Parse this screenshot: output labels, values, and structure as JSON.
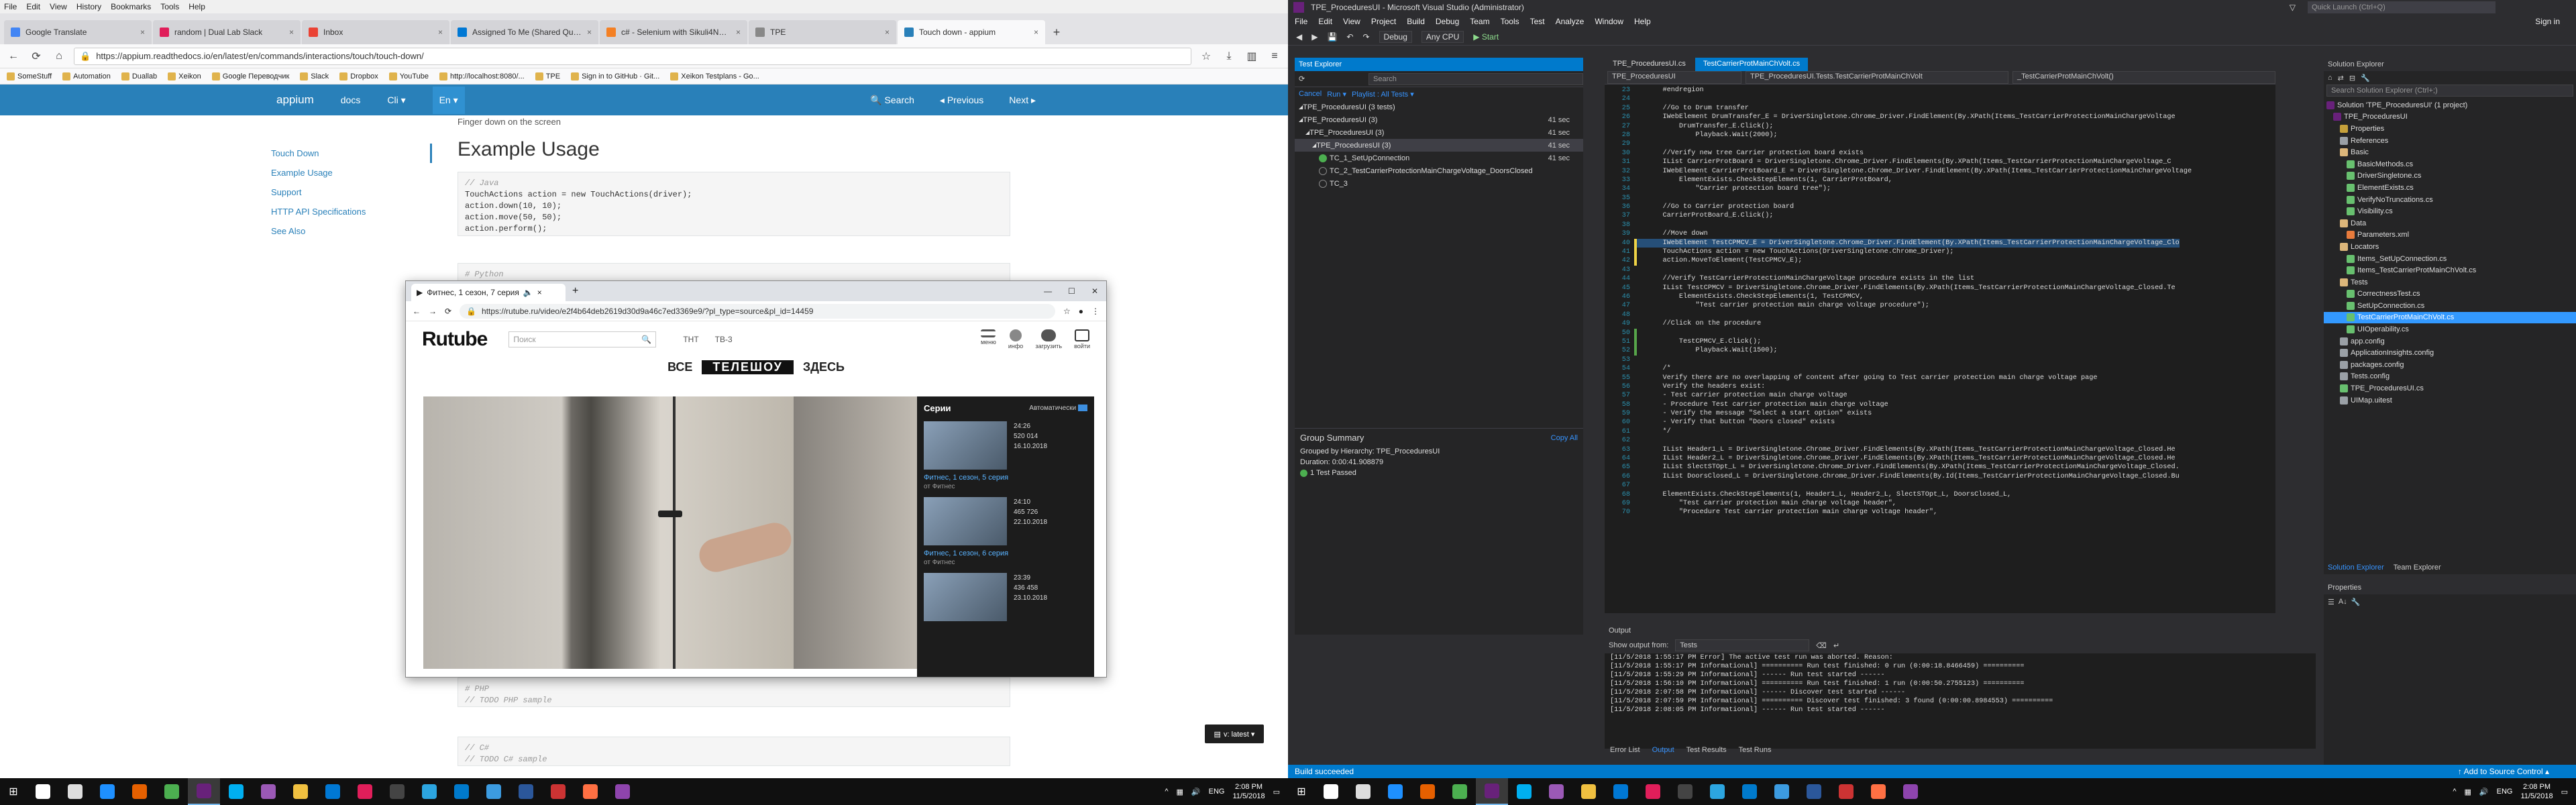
{
  "firefox": {
    "menu": [
      "File",
      "Edit",
      "View",
      "History",
      "Bookmarks",
      "Tools",
      "Help"
    ],
    "tabs": [
      {
        "label": "Google Translate",
        "color": "#4285f4",
        "active": false
      },
      {
        "label": "random | Dual Lab Slack",
        "color": "#e01e5a",
        "active": false
      },
      {
        "label": "Inbox",
        "color": "#ea4335",
        "active": false
      },
      {
        "label": "Assigned To Me (Shared Quer...",
        "color": "#0078d4",
        "active": false
      },
      {
        "label": "c# - Selenium with Sikuli4Net...",
        "color": "#f48024",
        "active": false
      },
      {
        "label": "TPE",
        "color": "#888888",
        "active": false
      },
      {
        "label": "Touch down - appium",
        "color": "#2980b9",
        "active": true
      }
    ],
    "url": "https://appium.readthedocs.io/en/latest/en/commands/interactions/touch/touch-down/",
    "bookmarks": [
      "SomeStuff",
      "Automation",
      "Duallab",
      "Xeikon",
      "Google Переводчик",
      "Slack",
      "Dropbox",
      "YouTube",
      "http://localhost:8080/...",
      "TPE",
      "Sign in to GitHub · Git...",
      "Xeikon Testplans - Go..."
    ]
  },
  "appium": {
    "brand": "appium",
    "nav": [
      "docs",
      "Cli ▾",
      "En ▾"
    ],
    "right_nav": [
      "Search",
      "◂ Previous",
      "Next ▸"
    ],
    "subtitle": "Finger down on the screen",
    "sidebar": [
      "Touch Down",
      "Example Usage",
      "Support",
      "HTTP API Specifications",
      "See Also"
    ],
    "title": "Example Usage",
    "code_java": [
      "// Java",
      "TouchActions action = new TouchActions(driver);",
      "action.down(10, 10);",
      "action.move(50, 50);",
      "action.perform();"
    ],
    "code_python": [
      "# Python"
    ],
    "code_php": [
      "# PHP",
      "// TODO PHP sample"
    ],
    "code_cs": [
      "// C#",
      "// TODO C# sample"
    ],
    "latest_label": "v: latest ▾"
  },
  "rutube": {
    "tab_label": "Фитнес, 1 сезон, 7 серия",
    "url": "https://rutube.ru/video/e2f4b64deb2619d30d9a46c7ed3369e9/?pl_type=source&pl_id=14459",
    "logo": "Rutube",
    "search_placeholder": "Поиск",
    "channels": [
      "ТНТ",
      "ТВ-3"
    ],
    "icons": [
      "меню",
      "инфо",
      "загрузить",
      "войти"
    ],
    "promo": [
      "ВСЕ",
      "ТЕЛЕШОУ",
      "ЗДЕСЬ"
    ],
    "series_title": "Серии",
    "series_auto": "Автоматически",
    "episodes": [
      {
        "duration": "24:26",
        "views": "520 014",
        "date": "16.10.2018",
        "title": "Фитнес, 1 сезон, 5 серия",
        "channel": "от Фитнес"
      },
      {
        "duration": "24:10",
        "views": "465 726",
        "date": "22.10.2018",
        "title": "Фитнес, 1 сезон, 6 серия",
        "channel": "от Фитнес"
      },
      {
        "duration": "23:39",
        "views": "436 458",
        "date": "23.10.2018",
        "title": "",
        "channel": ""
      }
    ]
  },
  "vs": {
    "title": "TPE_ProceduresUI - Microsoft Visual Studio (Administrator)",
    "quick_launch": "Quick Launch (Ctrl+Q)",
    "menu": [
      "File",
      "Edit",
      "View",
      "Project",
      "Build",
      "Debug",
      "Team",
      "Tools",
      "Test",
      "Analyze",
      "Window",
      "Help"
    ],
    "signin": "Sign in",
    "toolbar": [
      "Debug",
      "Any CPU",
      "▶ Start"
    ],
    "test_explorer": {
      "title": "Test Explorer",
      "tools": [
        "Cancel",
        "Run ▾",
        "Playlist : All Tests ▾"
      ],
      "search": "Search",
      "rows": [
        {
          "label": "TPE_ProceduresUI (3 tests)",
          "indent": 6,
          "dur": "",
          "sel": false,
          "icon": "none"
        },
        {
          "label": "TPE_ProceduresUI (3)",
          "indent": 6,
          "dur": "41 sec",
          "sel": false,
          "icon": "none"
        },
        {
          "label": "TPE_ProceduresUI (3)",
          "indent": 16,
          "dur": "41 sec",
          "sel": false,
          "icon": "none"
        },
        {
          "label": "TPE_ProceduresUI (3)",
          "indent": 26,
          "dur": "41 sec",
          "sel": true,
          "icon": "none"
        },
        {
          "label": "TC_1_SetUpConnection",
          "indent": 36,
          "dur": "41 sec",
          "sel": false,
          "icon": "ok"
        },
        {
          "label": "TC_2_TestCarrierProtectionMainChargeVoltage_DoorsClosed",
          "indent": 36,
          "dur": "",
          "sel": false,
          "icon": "warn"
        },
        {
          "label": "TC_3",
          "indent": 36,
          "dur": "",
          "sel": false,
          "icon": "warn"
        }
      ],
      "summary_title": "Group Summary",
      "copy_all": "Copy All",
      "summary_lines": [
        "Grouped by Hierarchy: TPE_ProceduresUI",
        "Duration: 0:00:41.908879",
        "1 Test Passed"
      ]
    },
    "editor": {
      "tabs": [
        {
          "label": "TPE_ProceduresUI.cs",
          "active": false
        },
        {
          "label": "TestCarrierProtMainChVolt.cs",
          "active": true
        }
      ],
      "nav": [
        "TPE_ProceduresUI",
        "TPE_ProceduresUI.Tests.TestCarrierProtMainChVolt",
        "_TestCarrierProtMainChVolt()"
      ],
      "lines": [
        {
          "n": "23",
          "t": "    #endregion",
          "k": "com"
        },
        {
          "n": "24",
          "t": "",
          "k": ""
        },
        {
          "n": "25",
          "t": "    //Go to Drum transfer",
          "k": "com"
        },
        {
          "n": "26",
          "t": "    IWebElement DrumTransfer_E = DriverSingletone.Chrome_Driver.FindElement(By.XPath(Items_TestCarrierProtectionMainChargeVoltage",
          "k": ""
        },
        {
          "n": "27",
          "t": "        DrumTransfer_E.Click();",
          "k": ""
        },
        {
          "n": "28",
          "t": "            Playback.Wait(2000);",
          "k": ""
        },
        {
          "n": "29",
          "t": "",
          "k": ""
        },
        {
          "n": "30",
          "t": "    //Verify new tree Carrier protection board exists",
          "k": "com"
        },
        {
          "n": "31",
          "t": "    IList CarrierProtBoard = DriverSingletone.Chrome_Driver.FindElements(By.XPath(Items_TestCarrierProtectionMainChargeVoltage_C",
          "k": ""
        },
        {
          "n": "32",
          "t": "    IWebElement CarrierProtBoard_E = DriverSingletone.Chrome_Driver.FindElement(By.XPath(Items_TestCarrierProtectionMainChargeVoltage",
          "k": ""
        },
        {
          "n": "33",
          "t": "        ElementExists.CheckStepElements(1, CarrierProtBoard,",
          "k": ""
        },
        {
          "n": "34",
          "t": "            \"Carrier protection board tree\");",
          "k": "str"
        },
        {
          "n": "35",
          "t": "",
          "k": ""
        },
        {
          "n": "36",
          "t": "    //Go to Carrier protection board",
          "k": "com"
        },
        {
          "n": "37",
          "t": "    CarrierProtBoard_E.Click();",
          "k": ""
        },
        {
          "n": "38",
          "t": "",
          "k": ""
        },
        {
          "n": "39",
          "t": "    //Move down",
          "k": "com"
        },
        {
          "n": "40",
          "t": "    IWebElement TestCPMCV_E = DriverSingletone.Chrome_Driver.FindElement(By.XPath(Items_TestCarrierProtectionMainChargeVoltage_Clo",
          "k": "sel"
        },
        {
          "n": "41",
          "t": "    TouchActions action = new TouchActions(DriverSingletone.Chrome_Driver);",
          "k": ""
        },
        {
          "n": "42",
          "t": "    action.MoveToElement(TestCPMCV_E);",
          "k": ""
        },
        {
          "n": "43",
          "t": "",
          "k": ""
        },
        {
          "n": "44",
          "t": "    //Verify TestCarrierProtectionMainChargeVoltage procedure exists in the list",
          "k": "com"
        },
        {
          "n": "45",
          "t": "    IList TestCPMCV = DriverSingletone.Chrome_Driver.FindElements(By.XPath(Items_TestCarrierProtectionMainChargeVoltage_Closed.Te",
          "k": ""
        },
        {
          "n": "46",
          "t": "        ElementExists.CheckStepElements(1, TestCPMCV,",
          "k": ""
        },
        {
          "n": "47",
          "t": "            \"Test carrier protection main charge voltage procedure\");",
          "k": "str"
        },
        {
          "n": "48",
          "t": "",
          "k": ""
        },
        {
          "n": "49",
          "t": "    //Click on the procedure",
          "k": "com"
        },
        {
          "n": "50",
          "t": "",
          "k": ""
        },
        {
          "n": "51",
          "t": "        TestCPMCV_E.Click();",
          "k": ""
        },
        {
          "n": "52",
          "t": "            Playback.Wait(1500);",
          "k": ""
        },
        {
          "n": "53",
          "t": "",
          "k": ""
        },
        {
          "n": "54",
          "t": "    /*",
          "k": "com"
        },
        {
          "n": "55",
          "t": "    Verify there are no overlapping of content after going to Test carrier protection main charge voltage page",
          "k": "com"
        },
        {
          "n": "56",
          "t": "    Verify the headers exist:",
          "k": "com"
        },
        {
          "n": "57",
          "t": "    - Test carrier protection main charge voltage",
          "k": "com"
        },
        {
          "n": "58",
          "t": "    - Procedure Test carrier protection main charge voltage",
          "k": "com"
        },
        {
          "n": "59",
          "t": "    - Verify the message \"Select a start option\" exists",
          "k": "com"
        },
        {
          "n": "60",
          "t": "    - Verify that button \"Doors closed\" exists",
          "k": "com"
        },
        {
          "n": "61",
          "t": "    */",
          "k": "com"
        },
        {
          "n": "62",
          "t": "",
          "k": ""
        },
        {
          "n": "63",
          "t": "    IList Header1_L = DriverSingletone.Chrome_Driver.FindElements(By.XPath(Items_TestCarrierProtectionMainChargeVoltage_Closed.He",
          "k": ""
        },
        {
          "n": "64",
          "t": "    IList Header2_L = DriverSingletone.Chrome_Driver.FindElements(By.XPath(Items_TestCarrierProtectionMainChargeVoltage_Closed.He",
          "k": ""
        },
        {
          "n": "65",
          "t": "    IList SlectSTOpt_L = DriverSingletone.Chrome_Driver.FindElements(By.XPath(Items_TestCarrierProtectionMainChargeVoltage_Closed.",
          "k": ""
        },
        {
          "n": "66",
          "t": "    IList DoorsClosed_L = DriverSingletone.Chrome_Driver.FindElements(By.Id(Items_TestCarrierProtectionMainChargeVoltage_Closed.Bu",
          "k": ""
        },
        {
          "n": "67",
          "t": "",
          "k": ""
        },
        {
          "n": "68",
          "t": "    ElementExists.CheckStepElements(1, Header1_L, Header2_L, SlectSTOpt_L, DoorsClosed_L,",
          "k": ""
        },
        {
          "n": "69",
          "t": "        \"Test carrier protection main charge voltage header\",",
          "k": "str"
        },
        {
          "n": "70",
          "t": "        \"Procedure Test carrier protection main charge voltage header\",",
          "k": "str"
        }
      ]
    },
    "solution": {
      "title": "Solution Explorer",
      "search": "Search Solution Explorer (Ctrl+;)",
      "rows": [
        {
          "label": "Solution 'TPE_ProceduresUI' (1 project)",
          "indent": 4,
          "color": "#68217a",
          "sel": false
        },
        {
          "label": "TPE_ProceduresUI",
          "indent": 14,
          "color": "#68217a",
          "sel": false
        },
        {
          "label": "Properties",
          "indent": 24,
          "color": "#c5a03a",
          "sel": false
        },
        {
          "label": "References",
          "indent": 24,
          "color": "#9aa0a6",
          "sel": false
        },
        {
          "label": "Basic",
          "indent": 24,
          "color": "#dcb67a",
          "sel": false
        },
        {
          "label": "BasicMethods.cs",
          "indent": 34,
          "color": "#68c06f",
          "sel": false
        },
        {
          "label": "DriverSingletone.cs",
          "indent": 34,
          "color": "#68c06f",
          "sel": false
        },
        {
          "label": "ElementExists.cs",
          "indent": 34,
          "color": "#68c06f",
          "sel": false
        },
        {
          "label": "VerifyNoTruncations.cs",
          "indent": 34,
          "color": "#68c06f",
          "sel": false
        },
        {
          "label": "Visibility.cs",
          "indent": 34,
          "color": "#68c06f",
          "sel": false
        },
        {
          "label": "Data",
          "indent": 24,
          "color": "#dcb67a",
          "sel": false
        },
        {
          "label": "Parameters.xml",
          "indent": 34,
          "color": "#e87b3c",
          "sel": false
        },
        {
          "label": "Locators",
          "indent": 24,
          "color": "#dcb67a",
          "sel": false
        },
        {
          "label": "Items_SetUpConnection.cs",
          "indent": 34,
          "color": "#68c06f",
          "sel": false
        },
        {
          "label": "Items_TestCarrierProtMainChVolt.cs",
          "indent": 34,
          "color": "#68c06f",
          "sel": false
        },
        {
          "label": "Tests",
          "indent": 24,
          "color": "#dcb67a",
          "sel": false
        },
        {
          "label": "CorrectnessTest.cs",
          "indent": 34,
          "color": "#68c06f",
          "sel": false
        },
        {
          "label": "SetUpConnection.cs",
          "indent": 34,
          "color": "#68c06f",
          "sel": false
        },
        {
          "label": "TestCarrierProtMainChVolt.cs",
          "indent": 34,
          "color": "#68c06f",
          "sel": true
        },
        {
          "label": "UIOperability.cs",
          "indent": 34,
          "color": "#68c06f",
          "sel": false
        },
        {
          "label": "app.config",
          "indent": 24,
          "color": "#9aa0a6",
          "sel": false
        },
        {
          "label": "ApplicationInsights.config",
          "indent": 24,
          "color": "#9aa0a6",
          "sel": false
        },
        {
          "label": "packages.config",
          "indent": 24,
          "color": "#9aa0a6",
          "sel": false
        },
        {
          "label": "Tests.config",
          "indent": 24,
          "color": "#9aa0a6",
          "sel": false
        },
        {
          "label": "TPE_ProceduresUI.cs",
          "indent": 24,
          "color": "#68c06f",
          "sel": false
        },
        {
          "label": "UIMap.uitest",
          "indent": 24,
          "color": "#9aa0a6",
          "sel": false
        }
      ],
      "tabs": [
        "Solution Explorer",
        "Team Explorer"
      ]
    },
    "properties_title": "Properties",
    "output": {
      "title": "Output",
      "show_from_label": "Show output from:",
      "show_from_value": "Tests",
      "lines": [
        "[11/5/2018 1:55:17 PM Error] The active test run was aborted. Reason:",
        "[11/5/2018 1:55:17 PM Informational] ========== Run test finished: 0 run (0:00:18.8466459) ==========",
        "[11/5/2018 1:55:29 PM Informational] ------ Run test started ------",
        "[11/5/2018 1:56:10 PM Informational] ========== Run test finished: 1 run (0:00:50.2755123) ==========",
        "[11/5/2018 2:07:58 PM Informational] ------ Discover test started ------",
        "[11/5/2018 2:07:59 PM Informational] ========== Discover test finished: 3 found (0:00:00.8984553) ==========",
        "[11/5/2018 2:08:05 PM Informational] ------ Run test started ------"
      ],
      "tabs": [
        "Error List",
        "Output",
        "Test Results",
        "Test Runs"
      ]
    },
    "status_left": "Build succeeded",
    "status_right": "↑ Add to Source Control ▴"
  },
  "taskbar_left": {
    "icons": [
      {
        "name": "search-icon",
        "color": "#ffffff"
      },
      {
        "name": "task-view-icon",
        "color": "#dddddd"
      },
      {
        "name": "edge-icon",
        "color": "#1e90ff"
      },
      {
        "name": "firefox-icon",
        "color": "#e66000"
      },
      {
        "name": "chrome-icon",
        "color": "#4caf50"
      },
      {
        "name": "visual-studio-icon",
        "color": "#68217a"
      },
      {
        "name": "skype-icon",
        "color": "#00aff0"
      },
      {
        "name": "app-icon-purple",
        "color": "#9b59b6"
      },
      {
        "name": "file-explorer-icon",
        "color": "#f0c040"
      },
      {
        "name": "mail-icon",
        "color": "#0078d4"
      },
      {
        "name": "slack-icon",
        "color": "#e01e5a"
      },
      {
        "name": "calculator-icon",
        "color": "#444444"
      },
      {
        "name": "telegram-icon",
        "color": "#2ca5e0"
      },
      {
        "name": "vs-code-icon",
        "color": "#007acc"
      },
      {
        "name": "notepad-icon",
        "color": "#3c9be0"
      },
      {
        "name": "word-icon",
        "color": "#2b579a"
      },
      {
        "name": "onedrive-icon",
        "color": "#cc3333"
      },
      {
        "name": "app-icon-orange",
        "color": "#ff7043"
      },
      {
        "name": "app-icon-purple-2",
        "color": "#8e44ad"
      }
    ],
    "tray_lang": "ENG",
    "time": "2:08 PM",
    "date": "11/5/2018"
  },
  "taskbar_right": {
    "tray_lang": "ENG",
    "time": "2:08 PM",
    "date": "11/5/2018"
  }
}
